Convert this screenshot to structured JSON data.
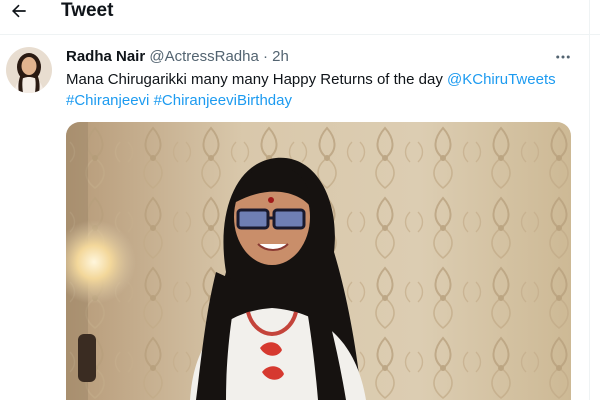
{
  "header": {
    "title": "Tweet",
    "back_icon": "arrow-left-icon"
  },
  "tweet": {
    "author": {
      "display_name": "Radha Nair",
      "handle": "@ActressRadha",
      "avatar": "user-avatar"
    },
    "separator": "·",
    "time": "2h",
    "more_icon": "more-horizontal-icon",
    "text": {
      "part1": "Mana Chirugarikki many many Happy Returns of the day ",
      "mention": "@KChiruTweets",
      "line_break_space": " ",
      "hashtag1": "#Chiranjeevi",
      "space": " ",
      "hashtag2": "#ChiranjeeviBirthday"
    },
    "media": {
      "kind": "video-still",
      "description_colors": {
        "wall": "#d8c8a8",
        "shirt": "#f2f0ec",
        "hair": "#161210",
        "accent": "#1d9bf0"
      }
    }
  }
}
